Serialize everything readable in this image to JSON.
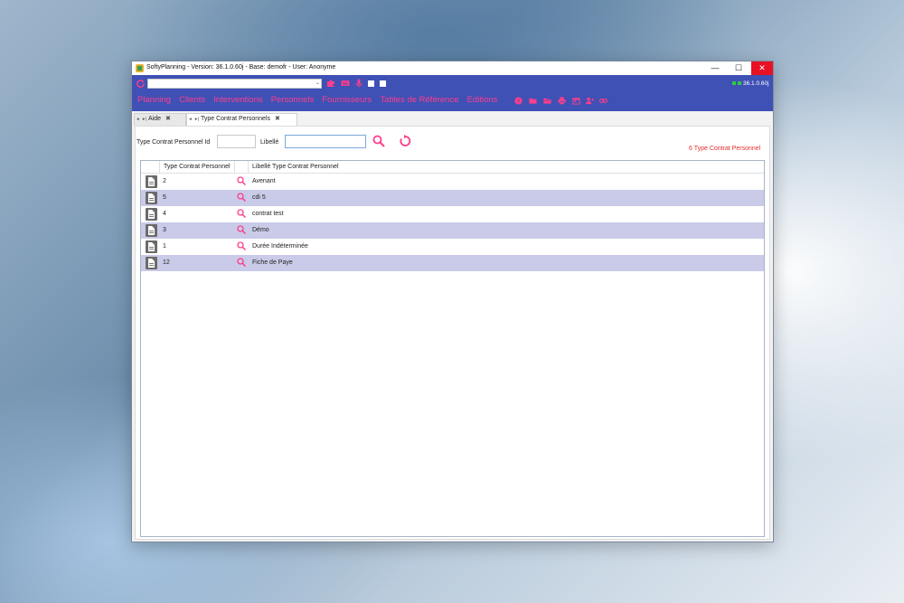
{
  "window": {
    "title": "SoftyPlanning - Version: 36.1.0.60j - Base: demofr - User: Anonyme",
    "controls": {
      "minimize": "—",
      "maximize": "☐",
      "close": "✕"
    }
  },
  "toolbar": {
    "combo_value": "",
    "icons": [
      "refresh-icon",
      "puzzle-icon",
      "keyboard-icon",
      "microphone-icon"
    ],
    "version_status": "36.1.0.60j",
    "status_color": "#2ecc40",
    "accent": "#3f51b5",
    "menu_color": "#ff3d8b"
  },
  "menu": {
    "items": [
      "Planning",
      "Clients",
      "Interventions",
      "Personnels",
      "Fournisseurs",
      "Tables de Référence",
      "Editions"
    ],
    "icons": [
      "help-icon",
      "folder-icon",
      "folder-open-icon",
      "print-icon",
      "calendar-icon",
      "users-icon",
      "link-icon"
    ]
  },
  "tabs": [
    {
      "label": "Aide",
      "close": "✖"
    },
    {
      "label": "Type Contrat Personnels",
      "close": "✖"
    }
  ],
  "filters": {
    "id_label": "Type Contrat Personnel Id",
    "id_value": "",
    "libelle_label": "Libellé",
    "libelle_value": "",
    "result_count": "6 Type Contrat Personnel"
  },
  "grid": {
    "columns": [
      "Type Contrat Personnel",
      "Libellé Type Contrat Personnel"
    ],
    "rows": [
      {
        "id": "2",
        "libelle": "Avenant"
      },
      {
        "id": "5",
        "libelle": "cdi 5"
      },
      {
        "id": "4",
        "libelle": "contrat test"
      },
      {
        "id": "3",
        "libelle": "Démo"
      },
      {
        "id": "1",
        "libelle": "Durée Indéterminée"
      },
      {
        "id": "12",
        "libelle": "Fiche de Paye"
      }
    ]
  }
}
